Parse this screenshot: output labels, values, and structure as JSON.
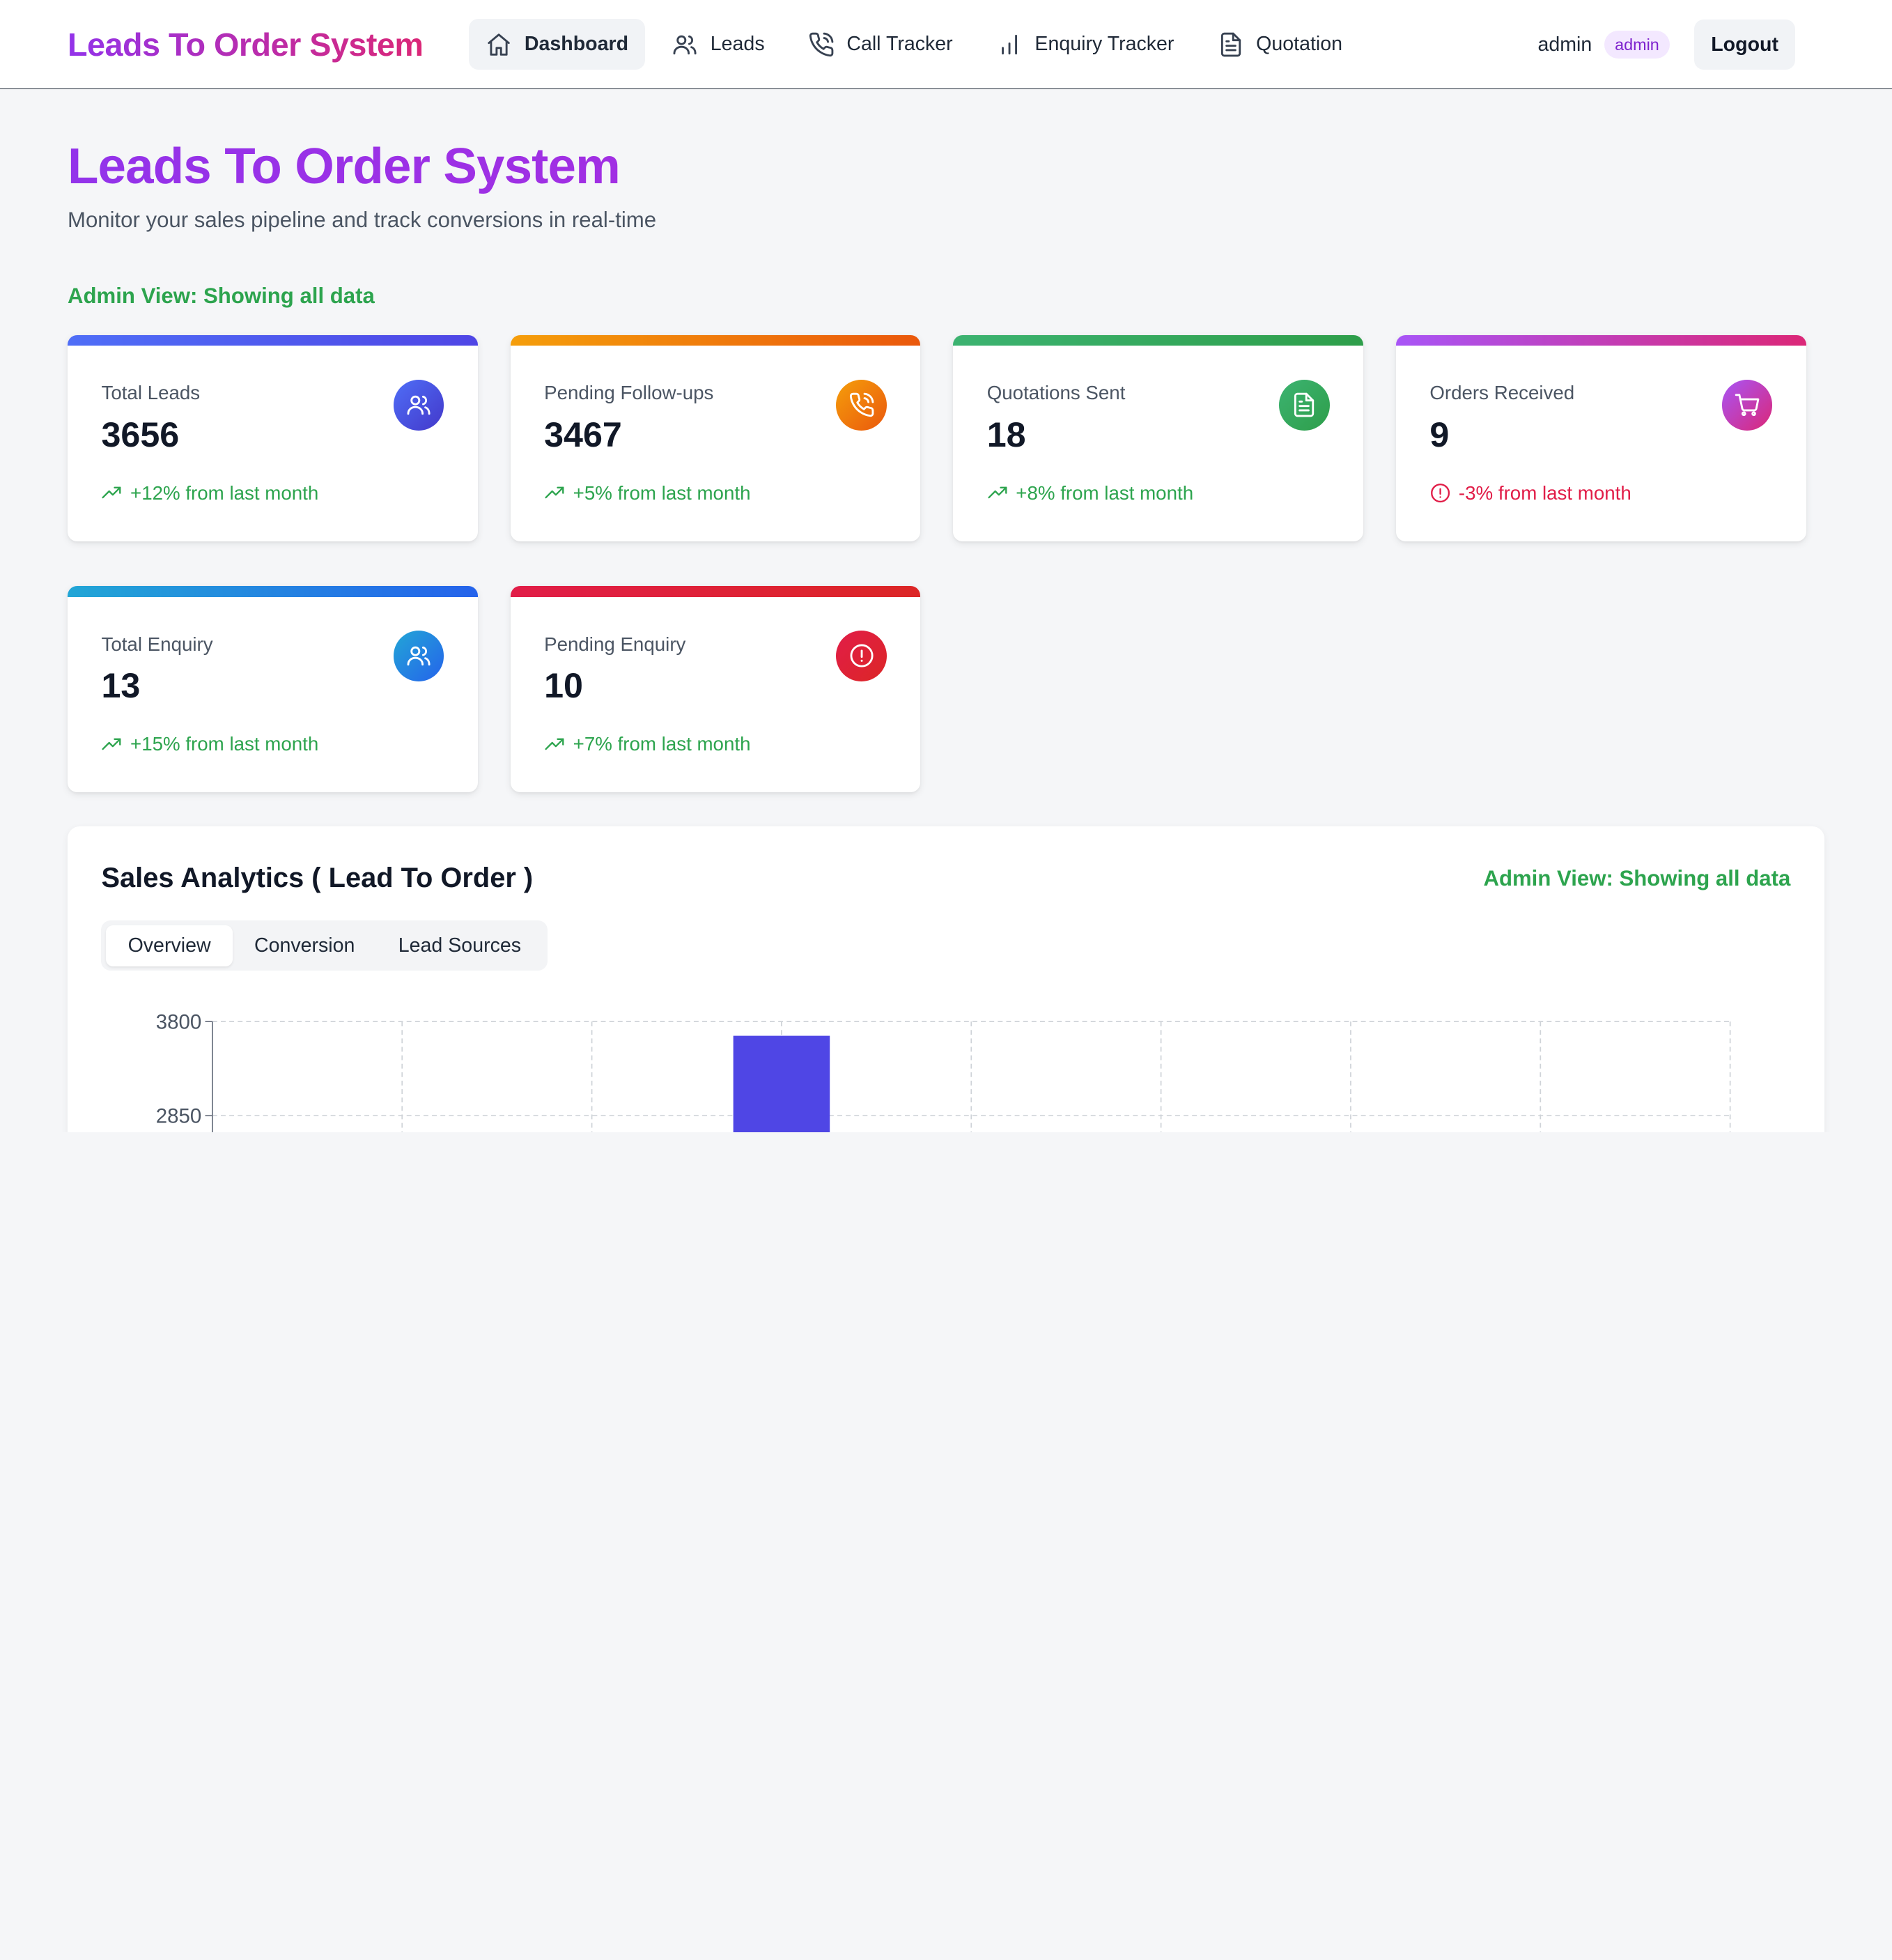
{
  "nav": {
    "brand": "Leads To Order System",
    "items": [
      {
        "label": "Dashboard",
        "icon": "home-icon",
        "active": true
      },
      {
        "label": "Leads",
        "icon": "users-icon"
      },
      {
        "label": "Call Tracker",
        "icon": "phone-call-icon"
      },
      {
        "label": "Enquiry Tracker",
        "icon": "bar-chart-icon"
      },
      {
        "label": "Quotation",
        "icon": "file-text-icon"
      }
    ],
    "user": "admin",
    "role": "admin",
    "logout": "Logout"
  },
  "page": {
    "title": "Leads To Order System",
    "subtitle": "Monitor your sales pipeline and track conversions in real-time",
    "admin_view": "Admin View: Showing all data"
  },
  "cards": [
    {
      "label": "Total Leads",
      "value": "3656",
      "trend": "+12% from last month",
      "direction": "up",
      "icon": "users-icon",
      "bar": [
        "#4f6ef7",
        "#4f46e5"
      ],
      "icon_bg": [
        "#4f6ef7",
        "#4338ca"
      ]
    },
    {
      "label": "Pending Follow-ups",
      "value": "3467",
      "trend": "+5% from last month",
      "direction": "up",
      "icon": "phone-call-icon",
      "bar": [
        "#f59e0b",
        "#ea580c"
      ],
      "icon_bg": [
        "#f59e0b",
        "#ea580c"
      ]
    },
    {
      "label": "Quotations Sent",
      "value": "18",
      "trend": "+8% from last month",
      "direction": "up",
      "icon": "file-text-icon",
      "bar": [
        "#3cb371",
        "#2e9e4a"
      ],
      "icon_bg": [
        "#3cb371",
        "#2e9e4a"
      ]
    },
    {
      "label": "Orders Received",
      "value": "9",
      "trend": "-3% from last month",
      "direction": "down",
      "icon": "shopping-cart-icon",
      "bar": [
        "#a855f7",
        "#db2777"
      ],
      "icon_bg": [
        "#a855f7",
        "#db2777"
      ]
    },
    {
      "label": "Total Enquiry",
      "value": "13",
      "trend": "+15% from last month",
      "direction": "up",
      "icon": "users-icon",
      "bar": [
        "#22a6d6",
        "#2563eb"
      ],
      "icon_bg": [
        "#22a6d6",
        "#2563eb"
      ]
    },
    {
      "label": "Pending Enquiry",
      "value": "10",
      "trend": "+7% from last month",
      "direction": "up",
      "icon": "alert-circle-icon",
      "bar": [
        "#e11d48",
        "#dc2626"
      ],
      "icon_bg": [
        "#e11d48",
        "#dc2626"
      ]
    }
  ],
  "analytics": {
    "title": "Sales Analytics ( Lead To Order )",
    "admin_view": "Admin View: Showing all data",
    "tabs": [
      "Overview",
      "Conversion",
      "Lead Sources"
    ],
    "active_tab": 0
  },
  "chart_data": {
    "type": "bar",
    "title": "",
    "xlabel": "",
    "ylabel": "",
    "ylim": [
      0,
      3800
    ],
    "y_ticks": [
      "3800",
      "2850"
    ],
    "categories": [
      "",
      "",
      "",
      ""
    ],
    "series": [
      {
        "values": [
          null,
          3656,
          null,
          null
        ],
        "color": "#4f46e5"
      }
    ],
    "grid": true
  }
}
